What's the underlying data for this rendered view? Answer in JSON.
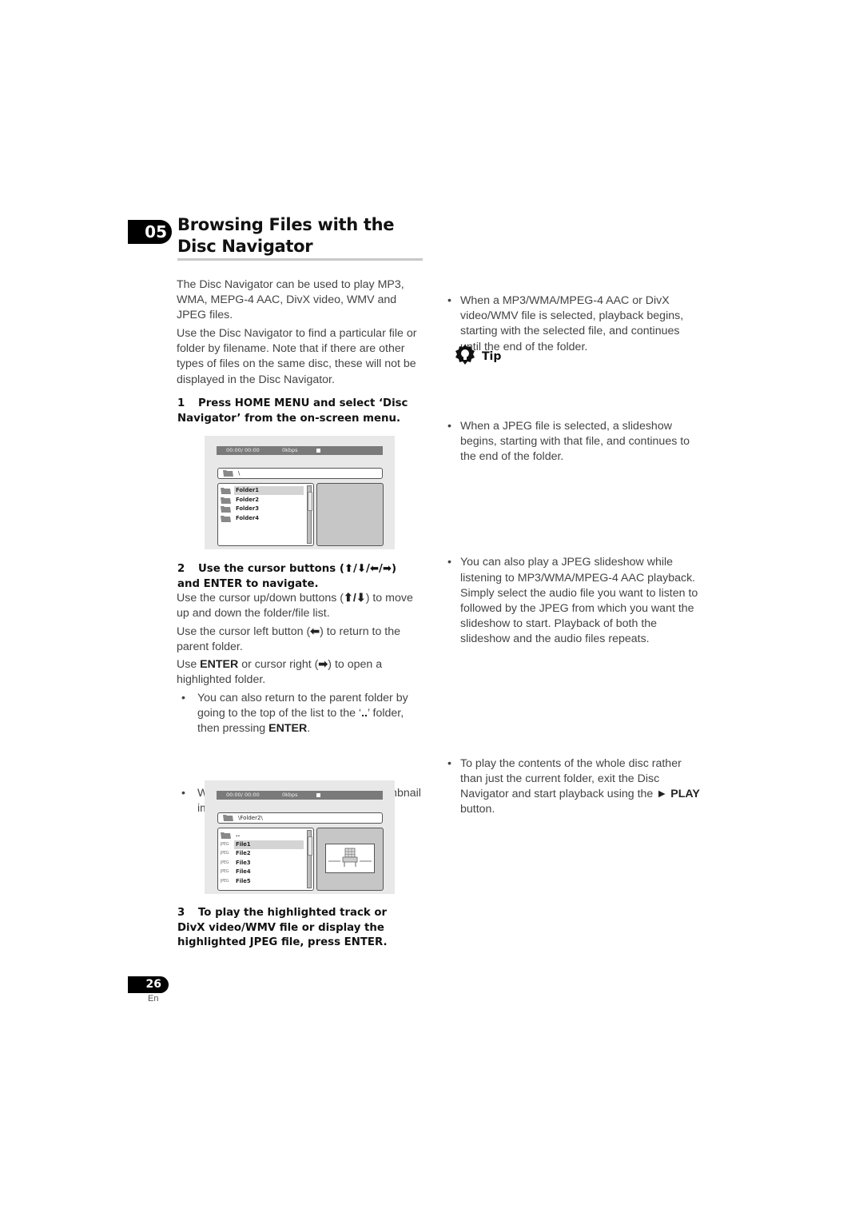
{
  "chapter": {
    "number": "05",
    "title": "Browsing Files with the Disc Navigator"
  },
  "intro": {
    "p1": "The Disc Navigator can be used to play MP3, WMA, MEPG-4 AAC, DivX video, WMV and JPEG files.",
    "p2": "Use the Disc Navigator to find a particular file or folder by filename. Note that if there are other types of files on the same disc, these will not be displayed in the Disc Navigator."
  },
  "step1": {
    "num": "1",
    "text": "Press HOME MENU and select ‘Disc Navigator’ from the on-screen menu."
  },
  "screen1": {
    "time": "00:00/ 00:00",
    "bitrate": "0kbps",
    "path": "\\",
    "items": [
      {
        "type": "folder",
        "label": "Folder1",
        "highlighted": true
      },
      {
        "type": "folder",
        "label": "Folder2",
        "highlighted": false
      },
      {
        "type": "folder",
        "label": "Folder3",
        "highlighted": false
      },
      {
        "type": "folder",
        "label": "Folder4",
        "highlighted": false
      }
    ]
  },
  "step2": {
    "num": "2",
    "heading_a": "Use the cursor buttons (",
    "heading_arrows": "⬆/⬇/⬅/➡",
    "heading_b": ") and ENTER to navigate.",
    "p1_a": "Use the cursor up/down buttons (",
    "p1_arrows": "⬆/⬇",
    "p1_b": ") to move up and down the folder/file list.",
    "p2_a": "Use the cursor left button (",
    "p2_arrow": "⬅",
    "p2_b": ") to return to the parent folder.",
    "p3_a": "Use ",
    "p3_bold": "ENTER",
    "p3_b": " or cursor right (",
    "p3_arrow": "➡",
    "p3_c": ") to open a highlighted folder.",
    "bullet1_a": "You can also return to the parent folder by going to the top of the list to the ‘",
    "bullet1_dots": "..",
    "bullet1_b": "’ folder, then pressing ",
    "bullet1_bold": "ENTER",
    "bullet1_c": ".",
    "bullet2": "When a JPEG file is highlighted, a thumbnail image is displayed on the right."
  },
  "screen2": {
    "time": "00:00/ 00:00",
    "bitrate": "0kbps",
    "path": "\\Folder2\\",
    "items": [
      {
        "type": "folder",
        "label": "..",
        "highlighted": false
      },
      {
        "type": "jpeg",
        "label": "File1",
        "highlighted": true
      },
      {
        "type": "jpeg",
        "label": "File2",
        "highlighted": false
      },
      {
        "type": "jpeg",
        "label": "File3",
        "highlighted": false
      },
      {
        "type": "jpeg",
        "label": "File4",
        "highlighted": false
      },
      {
        "type": "jpeg",
        "label": "File5",
        "highlighted": false
      }
    ],
    "jpeg_icon_text": "JPEG"
  },
  "step3": {
    "num": "3",
    "text": "To play the highlighted track or DivX video/WMV file or display the highlighted JPEG file, press ENTER."
  },
  "right_bullets": [
    "When a MP3/WMA/MPEG-4 AAC or DivX video/WMV file is selected, playback begins, starting with the selected file, and continues until the end of the folder.",
    "When a JPEG file is selected, a slideshow begins, starting with that file, and continues to the end of the folder."
  ],
  "tip": {
    "label": "Tip",
    "bullet1": "You can also play a JPEG slideshow while listening to MP3/WMA/MPEG-4 AAC playback. Simply select the audio file you want to listen to followed by the JPEG from which you want the slideshow to start. Playback of both the slideshow and the audio files repeats.",
    "bullet2_a": "To play the contents of the whole disc rather than just the current folder, exit the Disc Navigator and start playback using the ",
    "bullet2_play": "► PLAY",
    "bullet2_b": " button."
  },
  "footer": {
    "page": "26",
    "lang": "En"
  }
}
